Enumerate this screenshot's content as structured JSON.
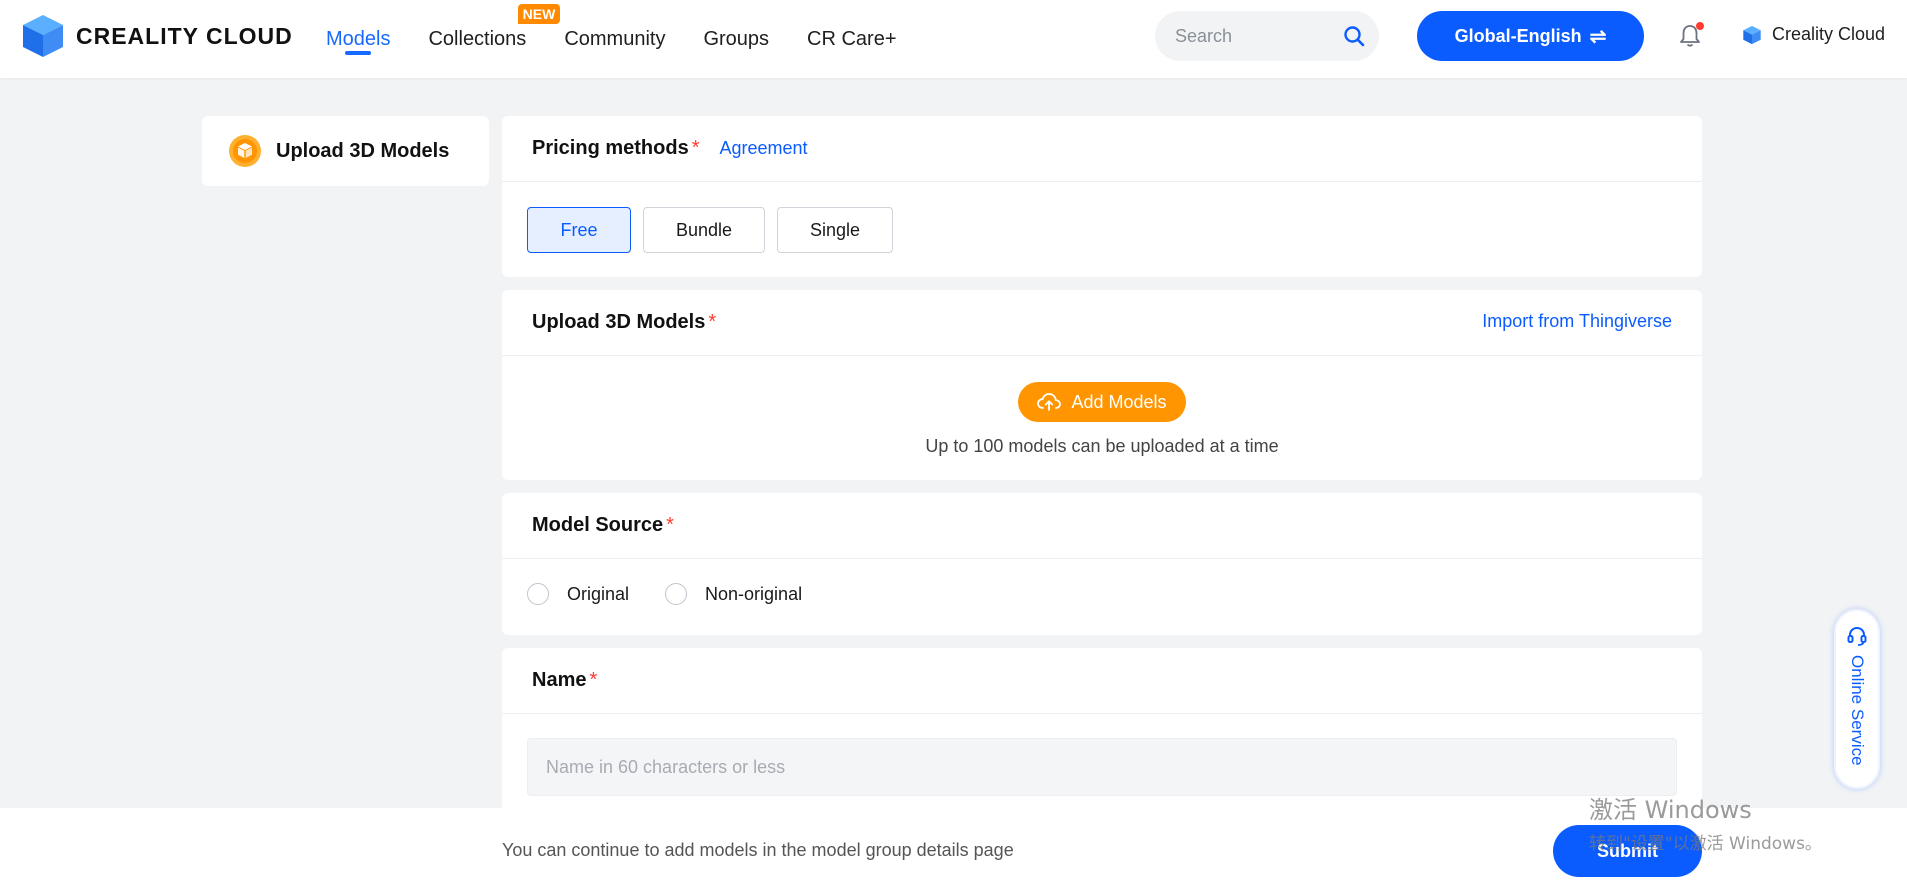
{
  "header": {
    "logo_text": "CREALITY CLOUD",
    "nav": [
      {
        "label": "Models",
        "active": true
      },
      {
        "label": "Collections",
        "badge": "NEW"
      },
      {
        "label": "Community"
      },
      {
        "label": "Groups"
      },
      {
        "label": "CR Care+"
      }
    ],
    "search_placeholder": "Search",
    "lang_button": "Global-English",
    "user_name": "Creality Cloud"
  },
  "sidebar": {
    "upload_label": "Upload 3D Models"
  },
  "pricing": {
    "title": "Pricing methods",
    "required_mark": "*",
    "agreement_link": "Agreement",
    "options": [
      "Free",
      "Bundle",
      "Single"
    ],
    "selected": "Free"
  },
  "upload": {
    "title": "Upload 3D Models",
    "required_mark": "*",
    "import_link": "Import from Thingiverse",
    "add_button": "Add Models",
    "hint": "Up to 100 models can be uploaded at a time"
  },
  "source": {
    "title": "Model Source",
    "required_mark": "*",
    "options": [
      "Original",
      "Non-original"
    ]
  },
  "name": {
    "title": "Name",
    "required_mark": "*",
    "placeholder": "Name in 60 characters or less",
    "value": ""
  },
  "footer": {
    "note": "You can continue to add models in the model group details page",
    "submit_label": "Submit"
  },
  "online_service": "Online Service",
  "watermark": {
    "line1": "激活 Windows",
    "line2": "转到\"设置\"以激活 Windows。"
  },
  "colors": {
    "accent": "#0b5cff",
    "orange": "#ff9500",
    "required": "#ff3b30"
  }
}
